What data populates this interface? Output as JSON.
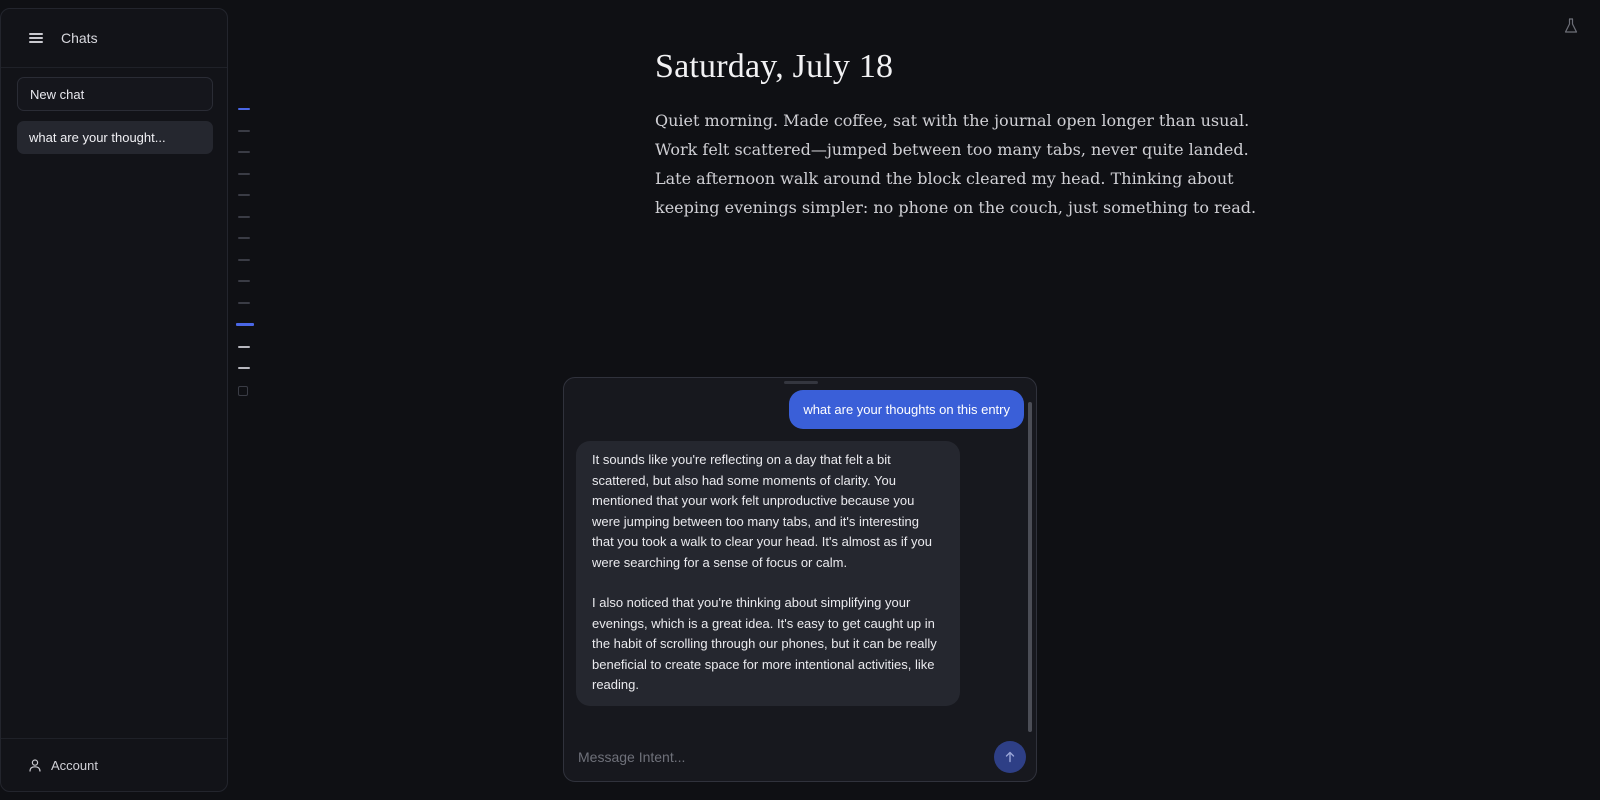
{
  "sidebar": {
    "title": "Chats",
    "new_chat_label": "New chat",
    "chats": [
      {
        "label": "what are your thought..."
      }
    ],
    "account_label": "Account"
  },
  "entry": {
    "title": "Saturday, July 18",
    "body": "Quiet morning. Made coffee, sat with the journal open longer than usual. Work felt scattered—jumped between too many tabs, never quite landed. Late afternoon walk around the block cleared my head. Thinking about keeping evenings simpler: no phone on the couch, just something to read."
  },
  "chat": {
    "user_message": "what are your thoughts on this entry",
    "assistant_paragraphs": [
      "It sounds like you're reflecting on a day that felt a bit scattered, but also had some moments of clarity. You mentioned that your work felt unproductive because you were jumping between too many tabs, and it's interesting that you took a walk to clear your head. It's almost as if you were searching for a sense of focus or calm.",
      "I also noticed that you're thinking about simplifying your evenings, which is a great idea. It's easy to get caught up in the habit of scrolling through our phones, but it can be really beneficial to create space for more intentional activities, like reading."
    ],
    "input_placeholder": "Message Intent..."
  },
  "icons": {
    "menu": "hamburger-icon",
    "account": "user-icon",
    "send": "arrow-up-icon",
    "top_right": "flask-icon",
    "calendar": "calendar-icon"
  },
  "colors": {
    "accent": "#3a5fd8",
    "background": "#0f1014",
    "sidebar": "#121318"
  }
}
